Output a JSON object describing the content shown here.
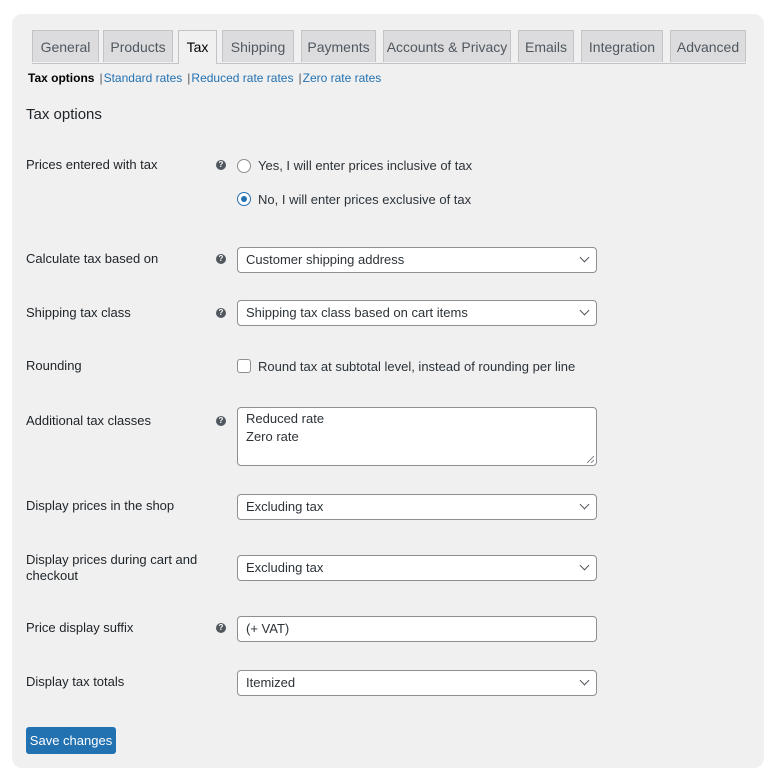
{
  "tabs": [
    {
      "label": "General",
      "active": false
    },
    {
      "label": "Products",
      "active": false
    },
    {
      "label": "Tax",
      "active": true
    },
    {
      "label": "Shipping",
      "active": false
    },
    {
      "label": "Payments",
      "active": false
    },
    {
      "label": "Accounts & Privacy",
      "active": false
    },
    {
      "label": "Emails",
      "active": false
    },
    {
      "label": "Integration",
      "active": false
    },
    {
      "label": "Advanced",
      "active": false
    }
  ],
  "subnav": {
    "current": "Tax options",
    "links": [
      "Standard rates",
      "Reduced rate rates",
      "Zero rate rates"
    ],
    "separator": "|"
  },
  "section_title": "Tax options",
  "help_glyph": "?",
  "fields": {
    "prices_entered": {
      "label": "Prices entered with tax",
      "options": [
        {
          "label": "Yes, I will enter prices inclusive of tax",
          "checked": false
        },
        {
          "label": "No, I will enter prices exclusive of tax",
          "checked": true
        }
      ]
    },
    "calculate_based_on": {
      "label": "Calculate tax based on",
      "value": "Customer shipping address"
    },
    "shipping_tax_class": {
      "label": "Shipping tax class",
      "value": "Shipping tax class based on cart items"
    },
    "rounding": {
      "label": "Rounding",
      "checkbox_label": "Round tax at subtotal level, instead of rounding per line",
      "checked": false
    },
    "additional_classes": {
      "label": "Additional tax classes",
      "lines": [
        "Reduced rate",
        "Zero rate"
      ]
    },
    "display_shop": {
      "label": "Display prices in the shop",
      "value": "Excluding tax"
    },
    "display_cart": {
      "label": "Display prices during cart and checkout",
      "value": "Excluding tax"
    },
    "price_suffix": {
      "label": "Price display suffix",
      "value": "(+ VAT)"
    },
    "display_totals": {
      "label": "Display tax totals",
      "value": "Itemized"
    }
  },
  "save_button": "Save changes",
  "colors": {
    "accent": "#2271b1",
    "panel_bg": "#f0f0f1",
    "tab_bg": "#dcdcde"
  }
}
